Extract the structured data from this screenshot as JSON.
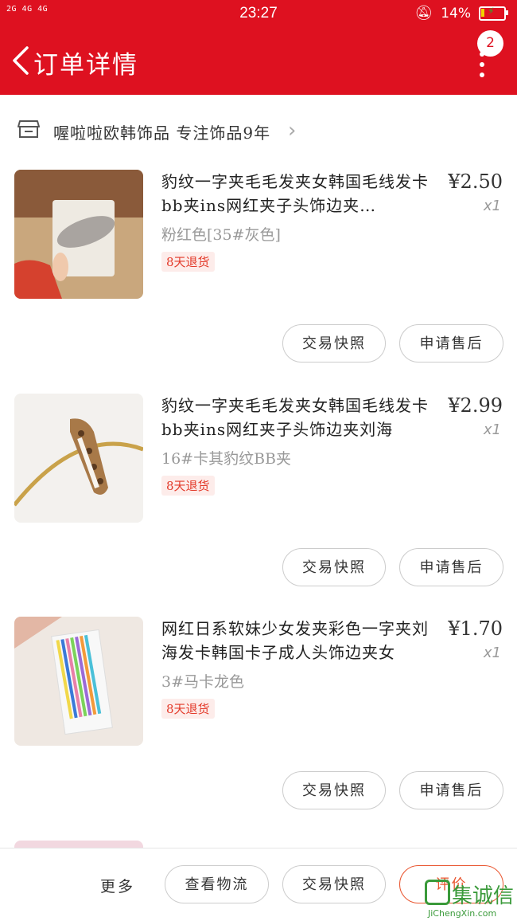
{
  "status_bar": {
    "signal": "2G 4G 4G",
    "time": "23:27",
    "battery": "14%",
    "battery_level": 0.14
  },
  "header": {
    "back_icon": "chevron-left-icon",
    "title": "订单详情",
    "notification_count": "2",
    "menu_icon": "more-vertical-icon"
  },
  "shop": {
    "icon": "store-icon",
    "name": "喔啦啦欧韩饰品 专注饰品9年"
  },
  "items": [
    {
      "title": "豹纹一字夹毛毛发夹女韩国毛线发卡bb夹ins网红夹子头饰边夹…",
      "price": "¥2.50",
      "qty": "x1",
      "variant": "粉红色[35#灰色]",
      "tag": "8天退货",
      "buttons": [
        "交易快照",
        "申请售后"
      ]
    },
    {
      "title": "豹纹一字夹毛毛发夹女韩国毛线发卡bb夹ins网红夹子头饰边夹刘海",
      "price": "¥2.99",
      "qty": "x1",
      "variant": "16#卡其豹纹BB夹",
      "tag": "8天退货",
      "buttons": [
        "交易快照",
        "申请售后"
      ]
    },
    {
      "title": "网红日系软妹少女发夹彩色一字夹刘海发卡韩国卡子成人头饰边夹女",
      "price": "¥1.70",
      "qty": "x1",
      "variant": "3#马卡龙色",
      "tag": "8天退货",
      "buttons": [
        "交易快照",
        "申请售后"
      ]
    }
  ],
  "bottom_bar": {
    "more": "更多",
    "logistics": "查看物流",
    "snapshot": "交易快照",
    "review": "评价"
  },
  "watermark": {
    "text": "集诚信",
    "url": "JiChengXin.com"
  },
  "colors": {
    "header_red": "#de1120",
    "accent_orange": "#e9552f",
    "tag_red": "#e33a2a"
  }
}
